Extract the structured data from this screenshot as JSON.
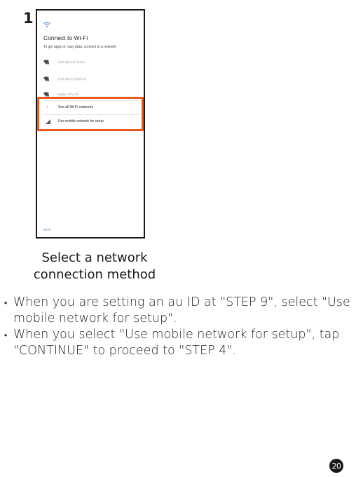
{
  "step_number": "1",
  "screen": {
    "title": "Connect to Wi-Fi",
    "subtitle": "To get apps or copy data, connect to a network",
    "networks": [
      "ICW-Wa-LR-TuHu",
      "ICW-Wa-LCEBO-D",
      "hqilbc 4TU ITI"
    ],
    "menu": [
      {
        "label": "See all Wi-Fi networks",
        "icon": "chevron-right-icon"
      },
      {
        "label": "Use mobile network for setup",
        "icon": "cellular-signal-icon"
      }
    ],
    "skip_label": "SKIP"
  },
  "highlight_color": "#e85a1e",
  "caption_lines": [
    "Select a network",
    "connection method"
  ],
  "bullets": [
    "When you are setting an au ID at \"STEP 9\", select \"Use mobile network for setup\".",
    "When you select \"Use mobile network for setup\", tap \"CONTINUE\" to proceed to \"STEP 4\"."
  ],
  "page_number": "20"
}
